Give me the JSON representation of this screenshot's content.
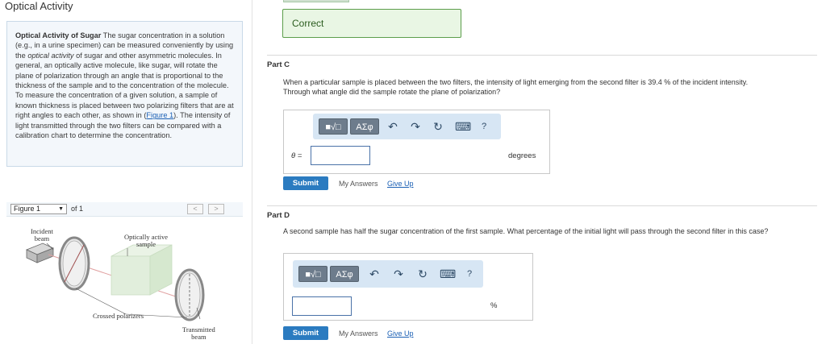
{
  "page": {
    "title": "Optical Activity"
  },
  "intro": {
    "bold_title": "Optical Activity of Sugar",
    "text_1": " The sugar concentration in a solution (e.g., in a urine specimen) can be measured conveniently by using the ",
    "italic": "optical activity",
    "text_2": " of sugar and other asymmetric molecules. In general, an optically active molecule, like sugar, will rotate the plane of polarization through an angle that is proportional to the thickness of the sample and to the concentration of the molecule. To measure the concentration of a given solution, a sample of known thickness is placed between two polarizing filters that are at right angles to each other, as shown in (",
    "link": "Figure 1",
    "text_3": "). The intensity of light transmitted through the two filters can be compared with a calibration chart to determine the concentration."
  },
  "figure": {
    "select_value": "Figure 1",
    "of_text": "of 1",
    "prev": "<",
    "next": ">",
    "labels": {
      "incident_1": "Incident",
      "incident_2": "beam",
      "sample_1": "Optically active",
      "sample_2": "sample",
      "crossed": "Crossed polarizers",
      "transmitted_1": "Transmitted",
      "transmitted_2": "beam"
    }
  },
  "feedback": {
    "correct": "Correct"
  },
  "part_c": {
    "label": "Part C",
    "question_1": "When a particular sample is placed between the two filters, the intensity of light emerging from the second filter is 39.4 % of the incident intensity.",
    "question_2": "Through what angle did the sample rotate the plane of polarization?",
    "var": "θ =",
    "input_value": "",
    "unit": "degrees"
  },
  "part_d": {
    "label": "Part D",
    "question": "A second sample has half the sugar concentration of the first sample. What percentage of the initial light will pass through the second filter in this case?",
    "input_value": "",
    "unit": "%"
  },
  "toolbar": {
    "template_btn": "■√□",
    "greek_btn": "ΑΣφ",
    "undo": "↶",
    "redo": "↷",
    "reset": "↻",
    "keyboard": "⌨",
    "help": "?"
  },
  "actions": {
    "submit": "Submit",
    "my_answers": "My Answers",
    "give_up": "Give Up"
  }
}
